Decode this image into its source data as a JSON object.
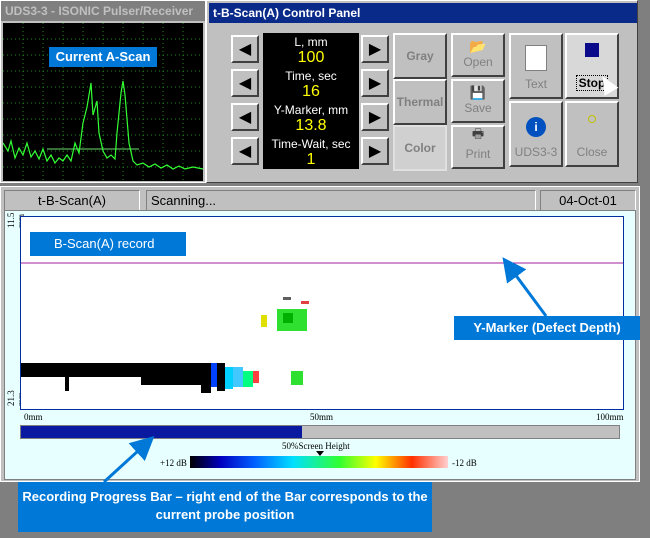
{
  "ascan": {
    "title": "UDS3-3 - ISONIC Pulser/Receiver",
    "callout": "Current A-Scan"
  },
  "control_panel": {
    "title": "t-B-Scan(A) Control Panel",
    "params": [
      {
        "label": "L, mm",
        "value": "100"
      },
      {
        "label": "Time, sec",
        "value": "16"
      },
      {
        "label": "Y-Marker, mm",
        "value": "13.8"
      },
      {
        "label": "Time-Wait, sec",
        "value": "1"
      }
    ],
    "palette_buttons": [
      "Gray",
      "Thermal",
      "Color"
    ],
    "action_buttons": {
      "open": "Open",
      "save": "Save",
      "print": "Print",
      "text": "Text",
      "stop": "Stop",
      "uds": "UDS3-3",
      "close": "Close"
    }
  },
  "status_bar": {
    "mode": "t-B-Scan(A)",
    "state": "Scanning...",
    "date": "04-Oct-01"
  },
  "bscan": {
    "callout": "B-Scan(A) record",
    "y_top_label": "11.5 mm",
    "y_bottom_label": "21.3 mm",
    "x_labels": [
      "0mm",
      "50mm",
      "100mm"
    ],
    "ymarker_callout": "Y-Marker (Defect Depth)",
    "progress_fraction": 0.47,
    "scale_title": "50%Screen Height",
    "scale_left": "+12 dB",
    "scale_right": "-12 dB"
  },
  "progress_callout": "Recording Progress Bar – right end of the Bar corresponds to the current probe position"
}
